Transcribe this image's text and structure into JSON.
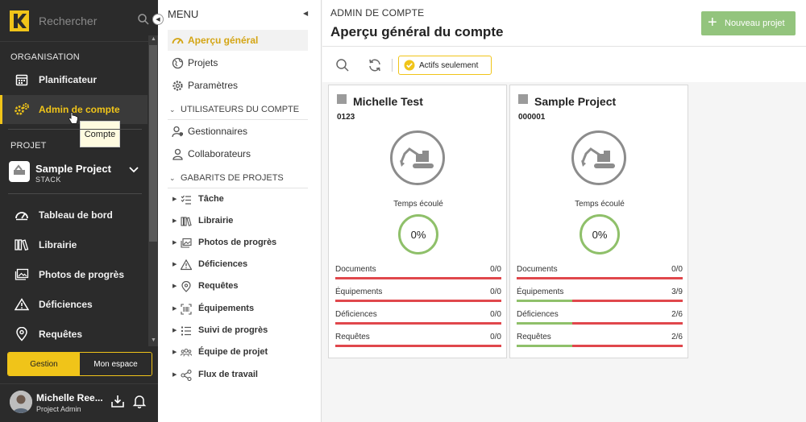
{
  "search": {
    "placeholder": "Rechercher"
  },
  "sidebar": {
    "org_title": "ORGANISATION",
    "org_items": [
      {
        "label": "Planificateur",
        "icon": "calendar-icon"
      },
      {
        "label": "Admin de compte",
        "icon": "gears-icon",
        "active": true
      }
    ],
    "tooltip": "Compte",
    "project_title": "PROJET",
    "project": {
      "name": "Sample Project",
      "sub": "STACK"
    },
    "project_items": [
      {
        "label": "Tableau de bord",
        "icon": "dashboard-icon"
      },
      {
        "label": "Librairie",
        "icon": "library-icon"
      },
      {
        "label": "Photos de progrès",
        "icon": "photos-icon"
      },
      {
        "label": "Déficiences",
        "icon": "warning-icon"
      },
      {
        "label": "Requêtes",
        "icon": "pin-icon"
      }
    ],
    "toggle": {
      "left": "Gestion",
      "right": "Mon espace"
    },
    "user": {
      "name": "Michelle Ree...",
      "role": "Project Admin"
    }
  },
  "menu": {
    "title": "MENU",
    "top_items": [
      {
        "label": "Aperçu général",
        "active": true
      },
      {
        "label": "Projets"
      },
      {
        "label": "Paramètres"
      }
    ],
    "users_section": "UTILISATEURS DU COMPTE",
    "users_items": [
      {
        "label": "Gestionnaires"
      },
      {
        "label": "Collaborateurs"
      }
    ],
    "templates_section": "GABARITS DE PROJETS",
    "templates_items": [
      {
        "label": "Tâche"
      },
      {
        "label": "Librairie"
      },
      {
        "label": "Photos de progrès"
      },
      {
        "label": "Déficiences"
      },
      {
        "label": "Requêtes"
      },
      {
        "label": "Équipements"
      },
      {
        "label": "Suivi de progrès"
      },
      {
        "label": "Équipe de projet"
      },
      {
        "label": "Flux de travail"
      }
    ]
  },
  "main": {
    "breadcrumb": "ADMIN DE COMPTE",
    "title": "Aperçu général du compte",
    "new_button": "Nouveau projet",
    "filter_chip": "Actifs seulement",
    "time_label": "Temps écoulé",
    "cards": [
      {
        "name": "Michelle Test",
        "code": "0123",
        "progress": "0%",
        "stats": [
          {
            "label": "Documents",
            "value": "0/0",
            "fraction": 0
          },
          {
            "label": "Équipements",
            "value": "0/0",
            "fraction": 0
          },
          {
            "label": "Déficiences",
            "value": "0/0",
            "fraction": 0
          },
          {
            "label": "Requêtes",
            "value": "0/0",
            "fraction": 0
          }
        ]
      },
      {
        "name": "Sample Project",
        "code": "000001",
        "progress": "0%",
        "stats": [
          {
            "label": "Documents",
            "value": "0/0",
            "fraction": 0
          },
          {
            "label": "Équipements",
            "value": "3/9",
            "fraction": 0.3333
          },
          {
            "label": "Déficiences",
            "value": "2/6",
            "fraction": 0.3333
          },
          {
            "label": "Requêtes",
            "value": "2/6",
            "fraction": 0.3333
          }
        ]
      }
    ]
  },
  "colors": {
    "accent": "#f0c419",
    "success": "#8fc06a",
    "danger": "#e0474c",
    "sidebar": "#2b2b2b"
  }
}
